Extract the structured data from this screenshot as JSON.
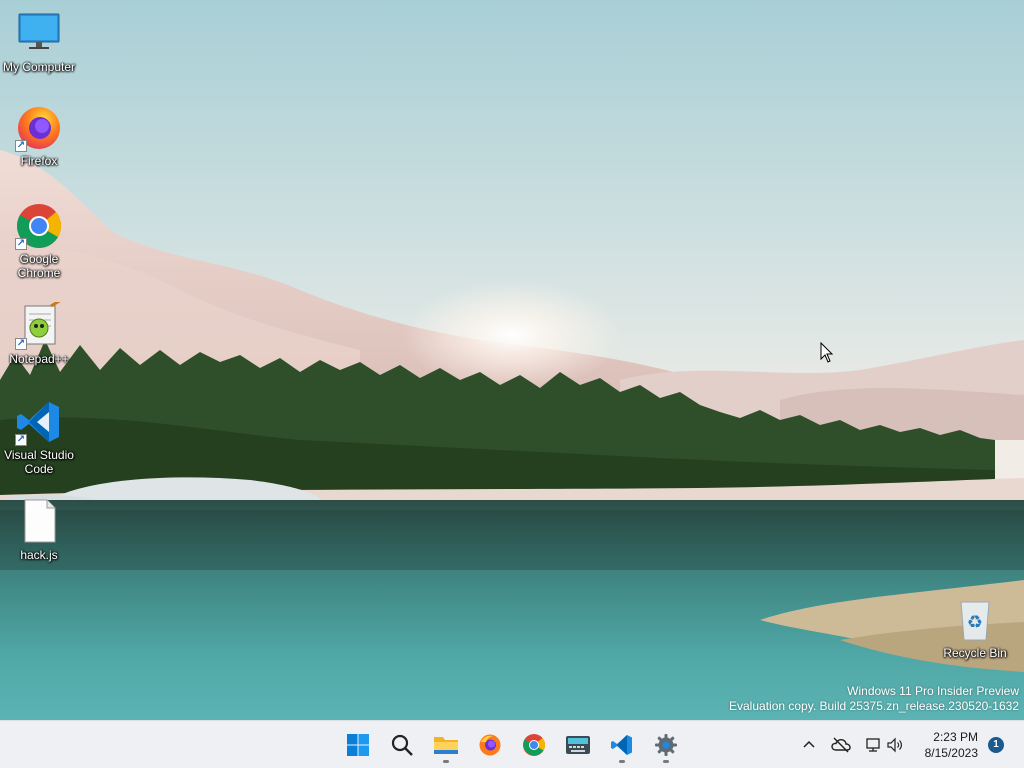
{
  "desktop_icons": [
    {
      "label": "My Computer",
      "icon": "monitor-icon",
      "shortcut": false
    },
    {
      "label": "Firefox",
      "icon": "firefox-icon",
      "shortcut": true
    },
    {
      "label": "Google Chrome",
      "icon": "chrome-icon",
      "shortcut": true
    },
    {
      "label": "Notepad++",
      "icon": "notepad-plus-plus-icon",
      "shortcut": true
    },
    {
      "label": "Visual Studio Code",
      "icon": "vscode-icon",
      "shortcut": true
    },
    {
      "label": "hack.js",
      "icon": "file-icon",
      "shortcut": false
    },
    {
      "label": "Recycle Bin",
      "icon": "recycle-bin-icon",
      "shortcut": false
    }
  ],
  "watermark": {
    "line1": "Windows 11 Pro Insider Preview",
    "line2": "Evaluation copy. Build 25375.zn_release.230520-1632"
  },
  "taskbar": {
    "apps": [
      {
        "name": "start",
        "icon": "windows-start-icon",
        "running": false
      },
      {
        "name": "search",
        "icon": "search-icon",
        "running": false
      },
      {
        "name": "file-explorer",
        "icon": "folder-icon",
        "running": true
      },
      {
        "name": "firefox",
        "icon": "firefox-icon",
        "running": false
      },
      {
        "name": "chrome",
        "icon": "chrome-icon",
        "running": false
      },
      {
        "name": "keyboard-app",
        "icon": "keyboard-icon",
        "running": false
      },
      {
        "name": "vscode",
        "icon": "vscode-icon",
        "running": true
      },
      {
        "name": "settings",
        "icon": "gear-icon",
        "running": true
      }
    ],
    "tray": {
      "icons": [
        "chevron-up-icon",
        "cloud-offline-icon",
        "network-icon",
        "volume-icon"
      ],
      "time": "2:23 PM",
      "date": "8/15/2023",
      "notification_count": "1"
    }
  },
  "colors": {
    "taskbar_bg": "#eef0f3",
    "accent_blue": "#0078d4"
  }
}
